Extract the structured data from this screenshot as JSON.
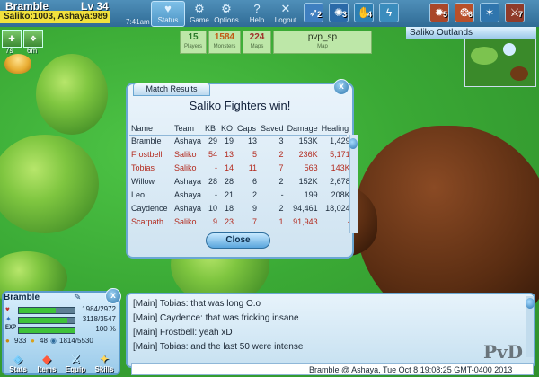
{
  "player": {
    "name": "Bramble",
    "level": "Lv 34"
  },
  "score_banner": "Saliko:1003, Ashaya:989",
  "clock": "7:41am",
  "nav": [
    {
      "label": "Status",
      "icon": "heart-icon",
      "glyph": "♥"
    },
    {
      "label": "Game",
      "icon": "gear-icon",
      "glyph": "⚙"
    },
    {
      "label": "Options",
      "icon": "wrench-icon",
      "glyph": "⚙"
    },
    {
      "label": "Help",
      "icon": "help-icon",
      "glyph": "?"
    },
    {
      "label": "Logout",
      "icon": "logout-icon",
      "glyph": "✕"
    }
  ],
  "skills": [
    {
      "num": "2",
      "icon": "skill-arrow-icon",
      "color": "#3f7fc0"
    },
    {
      "num": "3",
      "icon": "skill-burst-icon",
      "color": "#2a6aa8"
    },
    {
      "num": "4",
      "icon": "skill-hand-icon",
      "color": "#2d7fb3"
    },
    {
      "num": "",
      "icon": "skill-bolt-icon",
      "color": "#3a8cbd"
    },
    {
      "num": "5",
      "icon": "skill-fire-icon",
      "color": "#a9472a"
    },
    {
      "num": "6",
      "icon": "skill-flame-icon",
      "color": "#b8502a"
    },
    {
      "num": "",
      "icon": "skill-star-icon",
      "color": "#2f75ad"
    },
    {
      "num": "7",
      "icon": "skill-blade-icon",
      "color": "#8f3b2a"
    }
  ],
  "buffs": [
    {
      "label": "7s"
    },
    {
      "label": "6m"
    }
  ],
  "stats": [
    {
      "value": "15",
      "label": "Players",
      "color": "#2b7a2b"
    },
    {
      "value": "1584",
      "label": "Monsters",
      "color": "#c15a14"
    },
    {
      "value": "224",
      "label": "Maps",
      "color": "#a0302a"
    },
    {
      "value": "pvp_sp",
      "label": "Map",
      "color": "#23331d"
    }
  ],
  "minimap_title": "Saliko Outlands",
  "match": {
    "tab": "Match Results",
    "headline": "Saliko Fighters win!",
    "columns": [
      "Name",
      "Team",
      "KB",
      "KO",
      "Caps",
      "Saved",
      "Damage",
      "Healing"
    ],
    "rows": [
      {
        "team_color": "ashaya",
        "cells": [
          "Bramble",
          "Ashaya",
          "29",
          "19",
          "13",
          "3",
          "153K",
          "1,429"
        ]
      },
      {
        "team_color": "saliko",
        "cells": [
          "Frostbell",
          "Saliko",
          "54",
          "13",
          "5",
          "2",
          "236K",
          "5,171"
        ]
      },
      {
        "team_color": "saliko",
        "cells": [
          "Tobias",
          "Saliko",
          "-",
          "14",
          "11",
          "7",
          "563",
          "143K"
        ]
      },
      {
        "team_color": "ashaya",
        "cells": [
          "Willow",
          "Ashaya",
          "28",
          "28",
          "6",
          "2",
          "152K",
          "2,678"
        ]
      },
      {
        "team_color": "ashaya",
        "cells": [
          "Leo",
          "Ashaya",
          "-",
          "21",
          "2",
          "-",
          "199",
          "208K"
        ]
      },
      {
        "team_color": "ashaya",
        "cells": [
          "Caydence",
          "Ashaya",
          "10",
          "18",
          "9",
          "2",
          "94,461",
          "18,024"
        ]
      },
      {
        "team_color": "saliko",
        "cells": [
          "Scarpath",
          "Saliko",
          "9",
          "23",
          "7",
          "1",
          "91,943",
          "-"
        ]
      }
    ],
    "close_label": "Close",
    "close_x": "x"
  },
  "panel": {
    "name": "Bramble",
    "hp": {
      "text": "1984/2972",
      "fraction": 0.668,
      "color": "#3fc33a"
    },
    "mp": {
      "text": "3118/3547",
      "fraction": 0.879,
      "color": "#3fc33a"
    },
    "exp": {
      "label": "EXP",
      "text": "100 %",
      "fraction": 1.0,
      "color": "#3fc33a"
    },
    "gold": "933",
    "gems": "48",
    "energy": "1814/5530",
    "buttons": [
      {
        "label": "Stats",
        "icon": "stats-icon",
        "glyph": "◈"
      },
      {
        "label": "Items",
        "icon": "items-icon",
        "glyph": "◆"
      },
      {
        "label": "Equip",
        "icon": "equip-icon",
        "glyph": "⚔"
      },
      {
        "label": "Skills",
        "icon": "skills-icon",
        "glyph": "✦"
      }
    ],
    "close_x": "x"
  },
  "chat": {
    "lines": [
      "[Main] Tobias: that was long O.o",
      "[Main] Caydence: that was fricking insane",
      "[Main] Frostbell: yeah xD",
      "[Main] Tobias: and the last 50 were intense"
    ],
    "footer": "Bramble @ Ashaya, Tue Oct 8 19:08:25 GMT-0400 2013"
  },
  "logo_text": "PvD"
}
